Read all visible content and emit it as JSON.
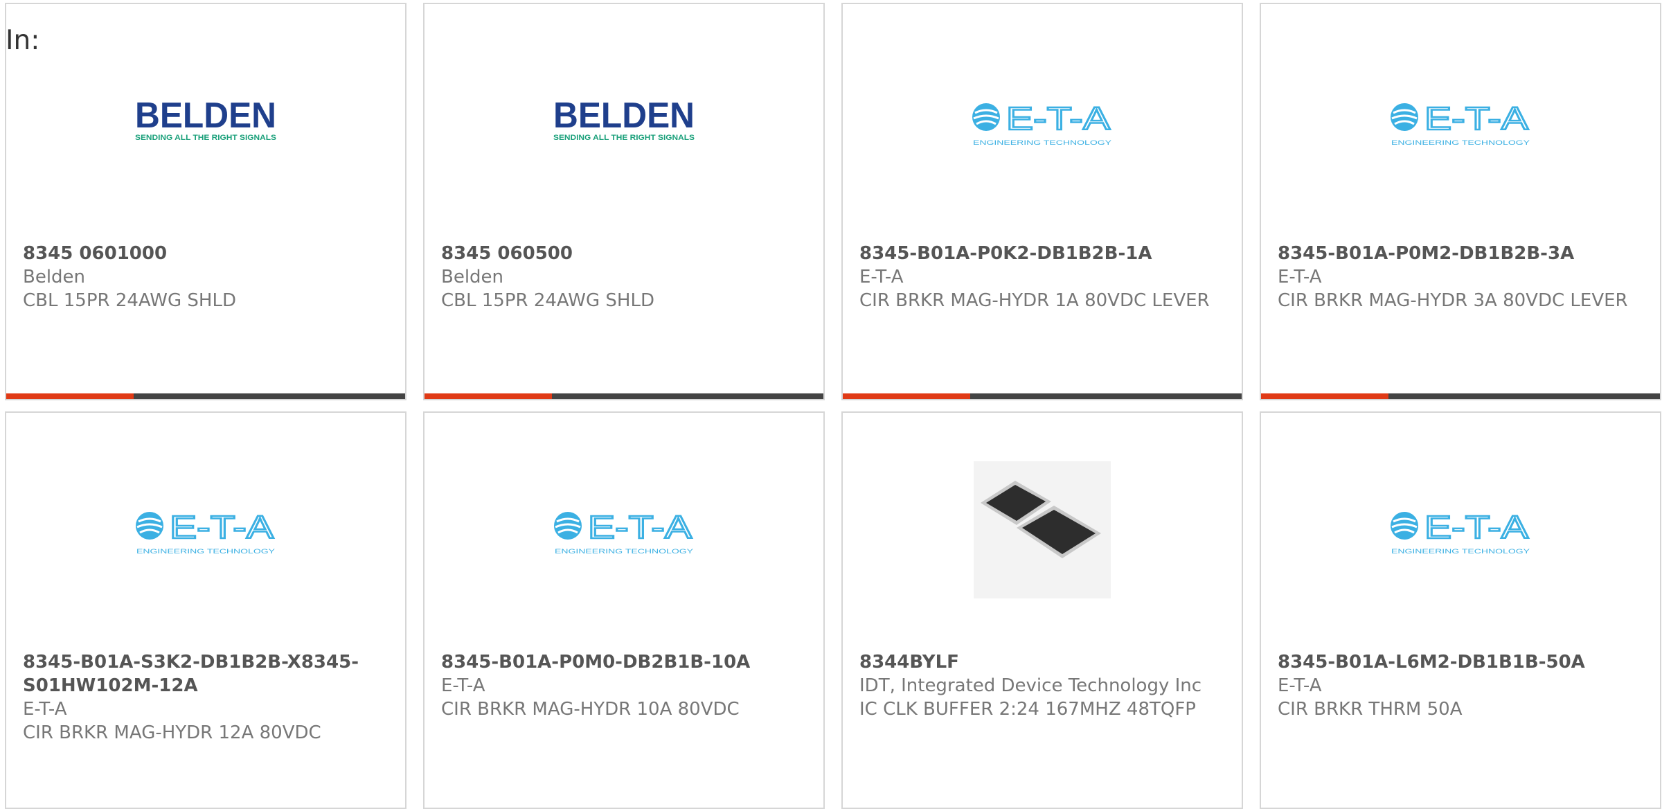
{
  "page": {
    "label": "In:"
  },
  "accent_color": "#e03a16",
  "cards": [
    {
      "image": "belden-logo",
      "logo_name": "BELDEN",
      "logo_tagline": "SENDING ALL THE RIGHT SIGNALS",
      "part_no": "8345 0601000",
      "maker": "Belden",
      "desc": "CBL 15PR 24AWG SHLD",
      "bar_fill_fraction": 0.32
    },
    {
      "image": "belden-logo",
      "logo_name": "BELDEN",
      "logo_tagline": "SENDING ALL THE RIGHT SIGNALS",
      "part_no": "8345 060500",
      "maker": "Belden",
      "desc": "CBL 15PR 24AWG SHLD",
      "bar_fill_fraction": 0.32
    },
    {
      "image": "eta-logo",
      "logo_name": "E-T-A",
      "logo_tagline": "ENGINEERING TECHNOLOGY",
      "part_no": "8345-B01A-P0K2-DB1B2B-1A",
      "maker": "E-T-A",
      "desc": "CIR BRKR MAG-HYDR 1A 80VDC LEVER",
      "bar_fill_fraction": 0.32
    },
    {
      "image": "eta-logo",
      "logo_name": "E-T-A",
      "logo_tagline": "ENGINEERING TECHNOLOGY",
      "part_no": "8345-B01A-P0M2-DB1B2B-3A",
      "maker": "E-T-A",
      "desc": "CIR BRKR MAG-HYDR 3A 80VDC LEVER",
      "bar_fill_fraction": 0.32
    },
    {
      "image": "eta-logo",
      "logo_name": "E-T-A",
      "logo_tagline": "ENGINEERING TECHNOLOGY",
      "part_no": "8345-B01A-S3K2-DB1B2B-X8345-S01HW102M-12A",
      "maker": "E-T-A",
      "desc": "CIR BRKR MAG-HYDR 12A 80VDC"
    },
    {
      "image": "eta-logo",
      "logo_name": "E-T-A",
      "logo_tagline": "ENGINEERING TECHNOLOGY",
      "part_no": "8345-B01A-P0M0-DB2B1B-10A",
      "maker": "E-T-A",
      "desc": "CIR BRKR MAG-HYDR 10A 80VDC"
    },
    {
      "image": "ic-chip-photo",
      "part_no": "8344BYLF",
      "maker": "IDT, Integrated Device Technology Inc",
      "desc": "IC CLK BUFFER 2:24 167MHZ 48TQFP"
    },
    {
      "image": "eta-logo",
      "logo_name": "E-T-A",
      "logo_tagline": "ENGINEERING TECHNOLOGY",
      "part_no": "8345-B01A-L6M2-DB1B1B-50A",
      "maker": "E-T-A",
      "desc": "CIR BRKR THRM 50A"
    }
  ]
}
